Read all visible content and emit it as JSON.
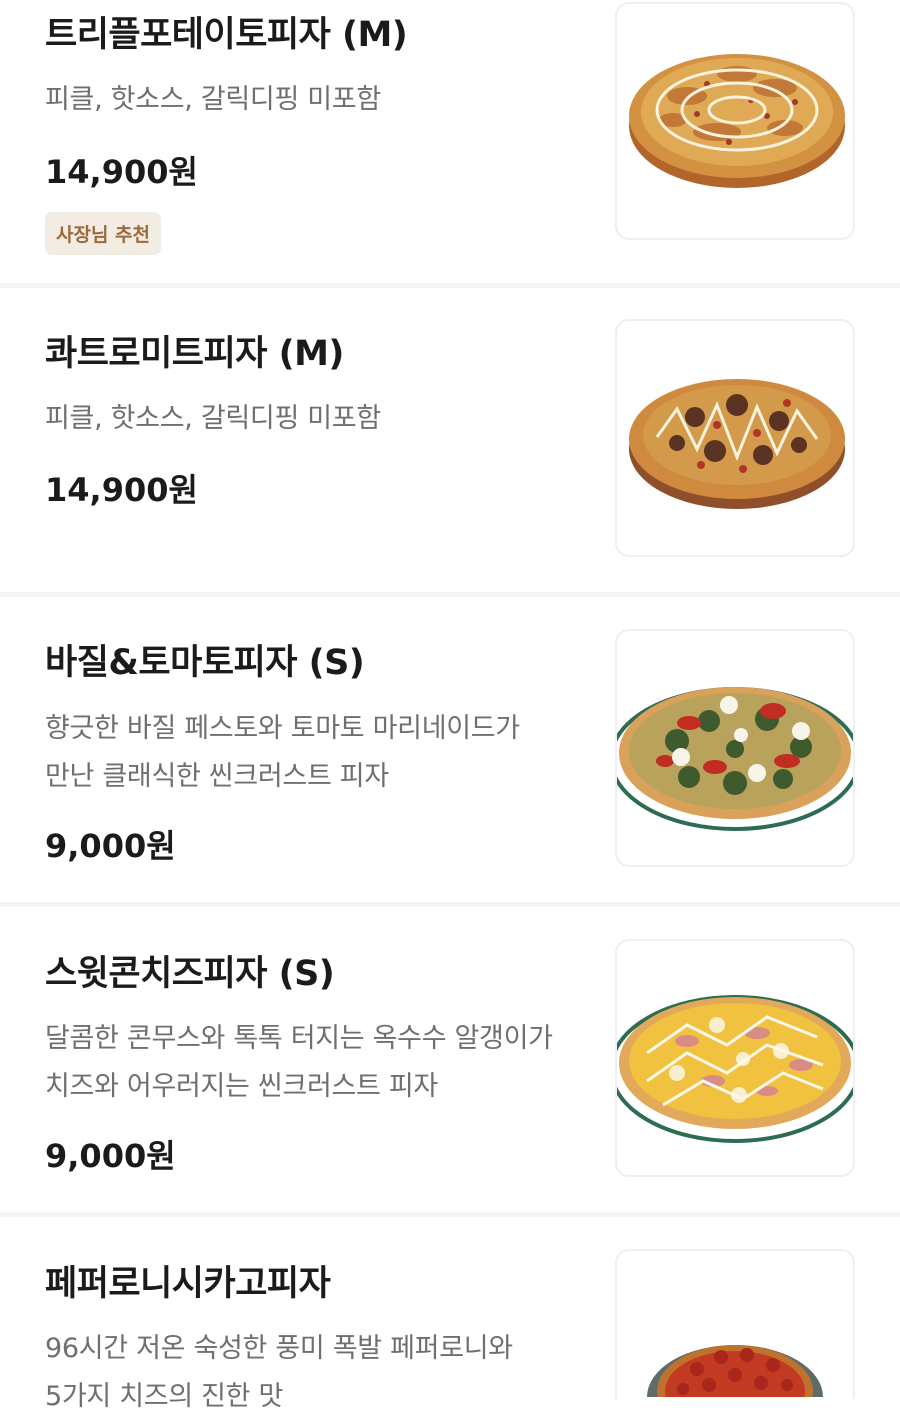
{
  "menu": {
    "items": [
      {
        "name": "트리플포테이토피자 (M)",
        "description": "피클, 핫소스, 갈릭디핑 미포함",
        "price": "14,900원",
        "badge": "사장님 추천",
        "image_icon": "triple-potato-pizza-photo"
      },
      {
        "name": "콰트로미트피자 (M)",
        "description": "피클, 핫소스, 갈릭디핑 미포함",
        "price": "14,900원",
        "image_icon": "quattro-meat-pizza-photo"
      },
      {
        "name": "바질&토마토피자 (S)",
        "description": "향긋한 바질 페스토와 토마토 마리네이드가\n만난 클래식한 씬크러스트 피자",
        "price": "9,000원",
        "image_icon": "basil-tomato-pizza-photo"
      },
      {
        "name": "스윗콘치즈피자 (S)",
        "description": "달콤한 콘무스와 톡톡 터지는 옥수수 알갱이가\n치즈와 어우러지는 씬크러스트 피자",
        "price": "9,000원",
        "image_icon": "sweet-corn-cheese-pizza-photo"
      },
      {
        "name": "페퍼로니시카고피자",
        "description": "96시간 저온 숙성한 풍미 폭발 페퍼로니와\n5가지 치즈의 진한 맛",
        "image_icon": "pepperoni-chicago-pizza-photo"
      }
    ]
  },
  "colors": {
    "badge_bg": "#f3ece3",
    "badge_text": "#9a6a3c",
    "divider": "#f4f4f4",
    "text_primary": "#1b1b1b",
    "text_secondary": "#6f6f6f"
  }
}
